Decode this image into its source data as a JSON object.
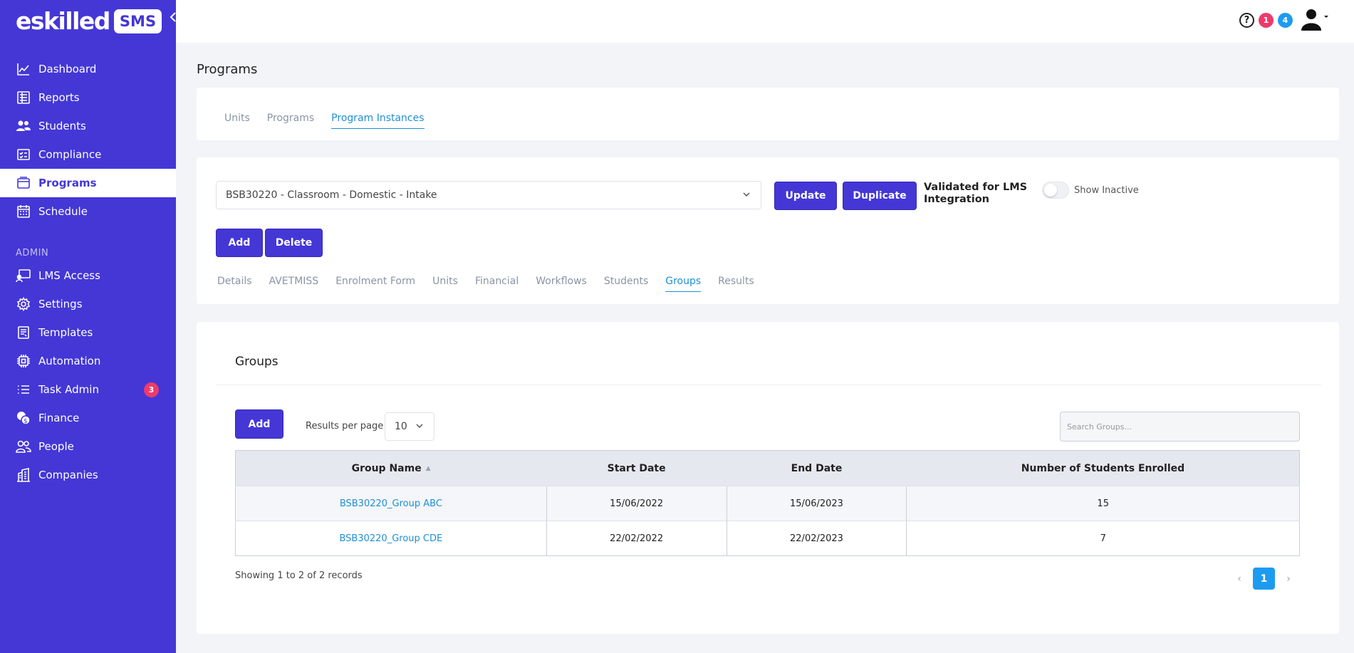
{
  "brand": {
    "name": "eskilled",
    "badge": "SMS"
  },
  "sidebar": {
    "items": [
      {
        "label": "Dashboard",
        "icon": "chart-line-icon"
      },
      {
        "label": "Reports",
        "icon": "report-icon"
      },
      {
        "label": "Students",
        "icon": "users-icon"
      },
      {
        "label": "Compliance",
        "icon": "checklist-icon"
      },
      {
        "label": "Programs",
        "icon": "programs-icon",
        "active": true
      },
      {
        "label": "Schedule",
        "icon": "calendar-icon"
      }
    ],
    "admin_label": "ADMIN",
    "admin_items": [
      {
        "label": "LMS Access",
        "icon": "lms-icon"
      },
      {
        "label": "Settings",
        "icon": "gear-icon"
      },
      {
        "label": "Templates",
        "icon": "template-icon"
      },
      {
        "label": "Automation",
        "icon": "chip-icon"
      },
      {
        "label": "Task Admin",
        "icon": "list-icon",
        "badge": "3"
      },
      {
        "label": "Finance",
        "icon": "coins-icon"
      },
      {
        "label": "People",
        "icon": "people-icon"
      },
      {
        "label": "Companies",
        "icon": "building-icon"
      }
    ]
  },
  "topbar": {
    "badge_pink": "1",
    "badge_blue": "4"
  },
  "page_title": "Programs",
  "top_tabs": [
    "Units",
    "Programs",
    "Program Instances"
  ],
  "program": {
    "selected": "BSB30220 - Classroom - Domestic - Intake",
    "update_label": "Update",
    "duplicate_label": "Duplicate",
    "validated_label": "Validated for LMS Integration",
    "show_inactive_label": "Show Inactive",
    "add_label": "Add",
    "delete_label": "Delete",
    "sub_tabs": [
      "Details",
      "AVETMISS",
      "Enrolment Form",
      "Units",
      "Financial",
      "Workflows",
      "Students",
      "Groups",
      "Results"
    ]
  },
  "groups": {
    "title": "Groups",
    "add_label": "Add",
    "rpp_label": "Results per page",
    "rpp_value": "10",
    "search_placeholder": "Search Groups...",
    "columns": [
      "Group Name",
      "Start Date",
      "End Date",
      "Number of Students Enrolled"
    ],
    "rows": [
      {
        "name": "BSB30220_Group ABC",
        "start": "15/06/2022",
        "end": "15/06/2023",
        "count": "15"
      },
      {
        "name": "BSB30220_Group CDE",
        "start": "22/02/2022",
        "end": "22/02/2023",
        "count": "7"
      }
    ],
    "showing": "Showing 1 to 2 of 2 records",
    "current_page": "1"
  },
  "colors": {
    "primary": "#4437d6",
    "link": "#1f8fd6",
    "badge": "#ee3a6b",
    "accent_blue": "#1d9bf0"
  }
}
